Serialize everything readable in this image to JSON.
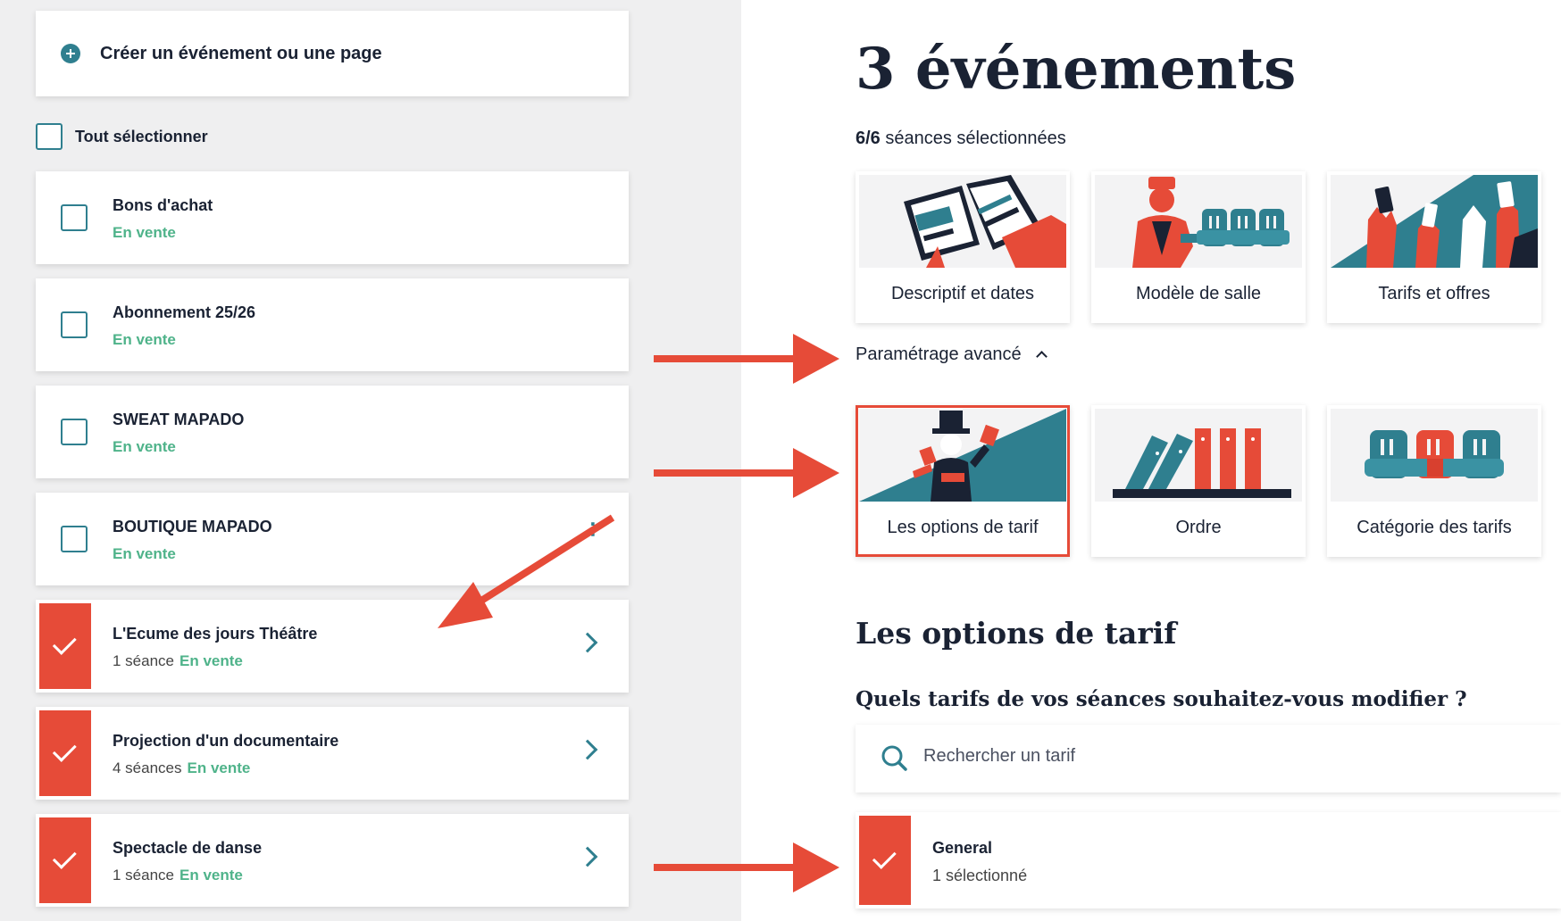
{
  "create": {
    "label": "Créer un événement ou une page"
  },
  "select_all": {
    "label": "Tout sélectionner"
  },
  "events": [
    {
      "title": "Bons d'achat",
      "seances": "",
      "status": "En vente",
      "selected": false
    },
    {
      "title": "Abonnement 25/26",
      "seances": "",
      "status": "En vente",
      "selected": false
    },
    {
      "title": "SWEAT MAPADO",
      "seances": "",
      "status": "En vente",
      "selected": false
    },
    {
      "title": "BOUTIQUE MAPADO",
      "seances": "",
      "status": "En vente",
      "selected": false,
      "menu": "⋮"
    },
    {
      "title": "L'Ecume des jours Théâtre",
      "seances": "1 séance",
      "status": "En vente",
      "selected": true
    },
    {
      "title": "Projection d'un documentaire",
      "seances": "4 séances",
      "status": "En vente",
      "selected": true
    },
    {
      "title": "Spectacle de danse",
      "seances": "1 séance",
      "status": "En vente",
      "selected": true
    }
  ],
  "main": {
    "title": "3 événements",
    "seances_count": "6/6",
    "seances_label": "séances sélectionnées",
    "tiles_top": [
      {
        "label": "Descriptif et dates",
        "icon": "book-illustration"
      },
      {
        "label": "Modèle de salle",
        "icon": "usher-seats-illustration"
      },
      {
        "label": "Tarifs et offres",
        "icon": "hands-tickets-illustration"
      }
    ],
    "advanced_label": "Paramétrage avancé",
    "tiles_advanced": [
      {
        "label": "Les options de tarif",
        "icon": "magician-illustration",
        "active": true
      },
      {
        "label": "Ordre",
        "icon": "dominoes-illustration",
        "active": false
      },
      {
        "label": "Catégorie des tarifs",
        "icon": "seats-illustration",
        "active": false
      }
    ],
    "section_title": "Les options de tarif",
    "question": "Quels tarifs de vos séances souhaitez-vous modifier ?",
    "search_placeholder": "Rechercher un tarif",
    "tarif": {
      "title": "General",
      "sub": "1 sélectionné"
    }
  },
  "colors": {
    "accent": "#e64b38",
    "teal": "#2f7f8f",
    "status_green": "#4fb38a",
    "navy": "#1a2233"
  }
}
